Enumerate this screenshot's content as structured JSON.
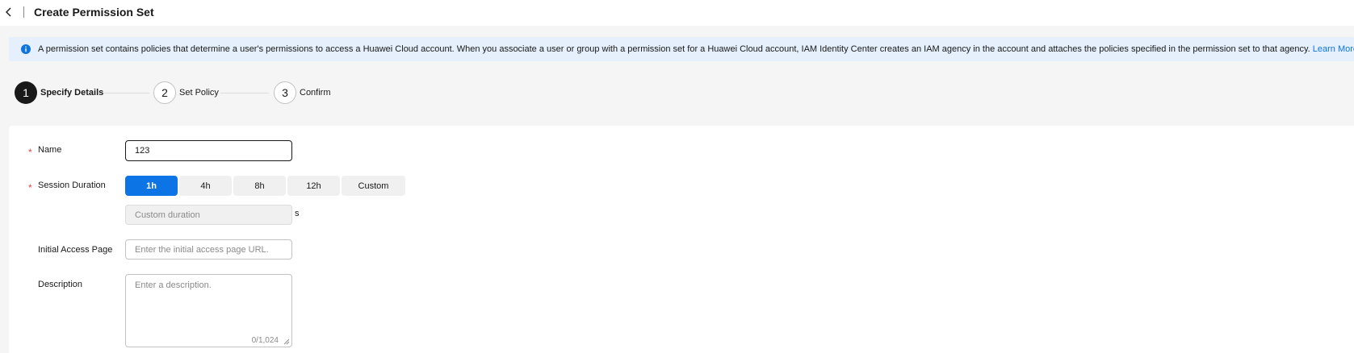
{
  "header": {
    "back_icon": "chevron-left-icon",
    "title": "Create Permission Set"
  },
  "banner": {
    "icon": "info-icon",
    "text": "A permission set contains policies that determine a user's permissions to access a Huawei Cloud account. When you associate a user or group with a permission set for a Huawei Cloud account, IAM Identity Center creates an IAM agency in the account and attaches the policies specified in the permission set to that agency.",
    "link": "Learn More"
  },
  "steps": [
    {
      "number": "1",
      "label": "Specify Details",
      "state": "active"
    },
    {
      "number": "2",
      "label": "Set Policy",
      "state": "inactive"
    },
    {
      "number": "3",
      "label": "Confirm",
      "state": "inactive"
    }
  ],
  "form": {
    "required_mark": "*",
    "name": {
      "label": "Name",
      "value": "123"
    },
    "session_duration": {
      "label": "Session Duration",
      "options": [
        "1h",
        "4h",
        "8h",
        "12h",
        "Custom"
      ],
      "selected": "1h",
      "custom_placeholder": "Custom duration",
      "unit": "s"
    },
    "initial_access_page": {
      "label": "Initial Access Page",
      "placeholder": "Enter the initial access page URL."
    },
    "description": {
      "label": "Description",
      "placeholder": "Enter a description.",
      "counter": "0/1,024"
    }
  },
  "colors": {
    "accent": "#0d74e6",
    "required": "#e54545",
    "banner_bg": "#e5f0fc",
    "step_active": "#191919"
  }
}
